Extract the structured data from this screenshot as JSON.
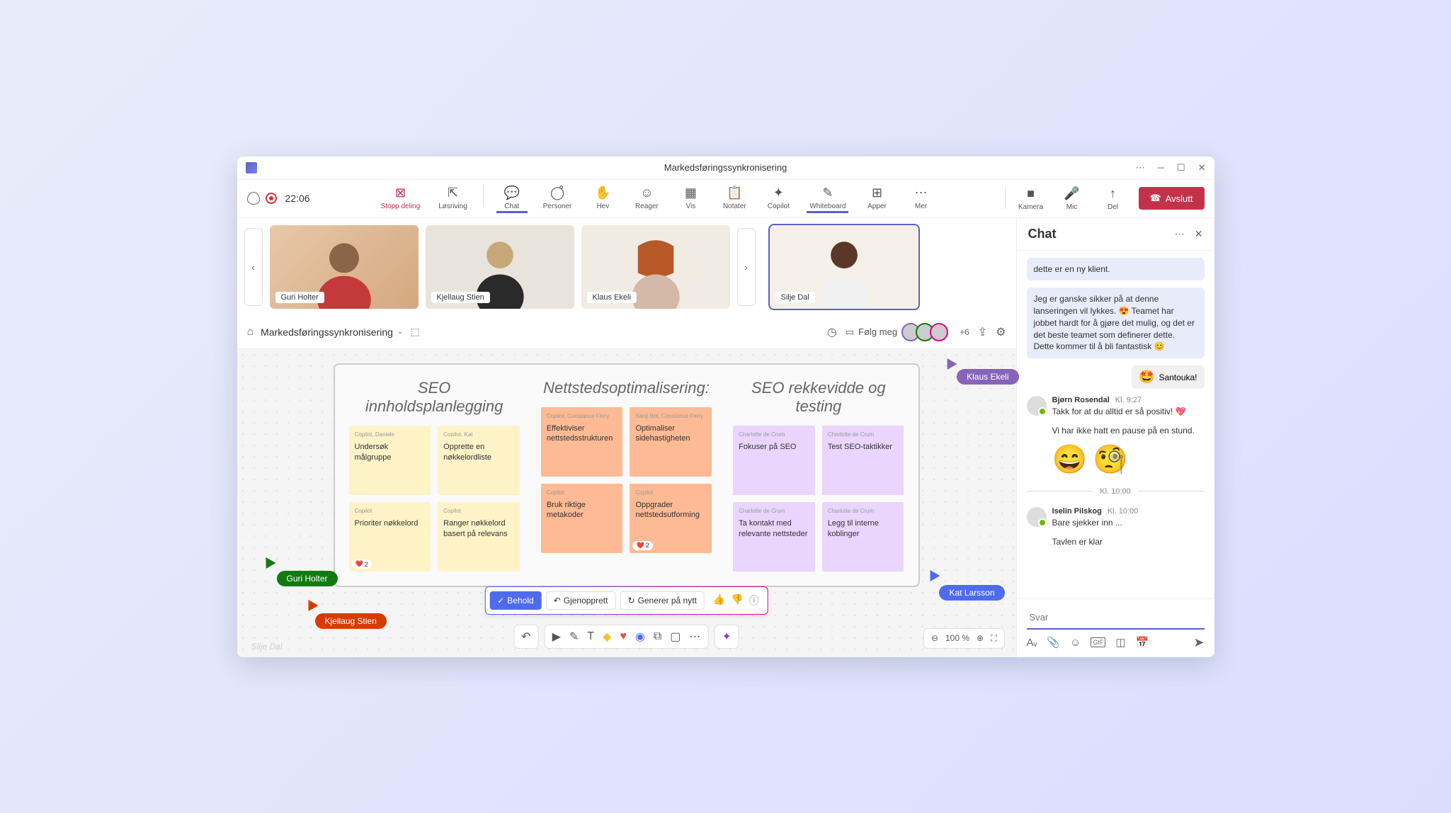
{
  "titlebar": {
    "title": "Markedsføringssynkronisering"
  },
  "meeting": {
    "timer": "22:06"
  },
  "toolbar": {
    "stop_sharing": "Stopp deling",
    "popout": "Løsriving",
    "chat": "Chat",
    "people": "Personer",
    "raise": "Hev",
    "react": "Reager",
    "view": "Vis",
    "notes": "Notater",
    "copilot": "Copilot",
    "whiteboard": "Whiteboard",
    "apps": "Apper",
    "more": "Mer",
    "camera": "Kamera",
    "mic": "Mic",
    "share": "Del",
    "leave": "Avslutt"
  },
  "participants": [
    {
      "name": "Guri Holter"
    },
    {
      "name": "Kjellaug Stien"
    },
    {
      "name": "Klaus Ekeli"
    },
    {
      "name": "Silje Dal"
    }
  ],
  "wb": {
    "title": "Markedsføringssynkronisering",
    "follow": "Følg meg",
    "more_count": "+6",
    "zoom": "100 %",
    "columns": [
      {
        "title": "SEO innholdsplanlegging",
        "color": "yellow",
        "notes": [
          {
            "author": "Copilot, Daniele",
            "text": "Undersøk målgruppe"
          },
          {
            "author": "Copilot, Kat",
            "text": "Opprette en nøkkelordliste"
          },
          {
            "author": "Copilot",
            "text": "Prioriter nøkkelord",
            "reaction": "2"
          },
          {
            "author": "Copilot",
            "text": "Ranger nøkkelord basert på relevans"
          }
        ]
      },
      {
        "title": "Nettstedsoptimalisering:",
        "color": "orange",
        "notes": [
          {
            "author": "Copilot, Constance Ferry",
            "text": "Effektiviser nettstedsstrukturen"
          },
          {
            "author": "Sanji Brit, Constance Ferry",
            "text": "Optimaliser sidehastigheten"
          },
          {
            "author": "Copilot",
            "text": "Bruk riktige metakoder"
          },
          {
            "author": "Copilot",
            "text": "Oppgrader nettstedsutforming",
            "reaction": "2"
          }
        ]
      },
      {
        "title": "SEO rekkevidde og testing",
        "color": "purple",
        "notes": [
          {
            "author": "Charlotte de Crum",
            "text": "Fokuser på SEO"
          },
          {
            "author": "Charlotte de Crum",
            "text": "Test SEO-taktikker"
          },
          {
            "author": "Charlotte de Crum",
            "text": "Ta kontakt med relevante nettsteder"
          },
          {
            "author": "Charlotte de Crum",
            "text": "Legg til interne koblinger"
          }
        ]
      }
    ],
    "cursors": {
      "klaus": "Klaus Ekeli",
      "guri": "Guri Holter",
      "kjellaug": "Kjellaug Stien",
      "kat": "Kat Larsson",
      "silje": "Silje Dal"
    },
    "ai": {
      "keep": "Behold",
      "restore": "Gjenopprett",
      "regenerate": "Generer på nytt"
    }
  },
  "chat": {
    "title": "Chat",
    "msg1": "dette er en ny klient.",
    "msg2": "Jeg er ganske sikker på at denne lanseringen vil lykkes. 😍 Teamet har jobbet hardt for å gjøre det mulig, og det er det beste teamet som definerer dette. Dette kommer til å bli fantastisk 😊",
    "reaction_name": "Santouka!",
    "bjorn": {
      "name": "Bjørn Rosendal",
      "time": "Kl. 9:27",
      "text1": "Takk for at du alltid er så positiv! 💖",
      "text2": "Vi har ikke hatt en pause på en stund."
    },
    "divider_time": "Kl. 10:00",
    "iselin": {
      "name": "Iselin Pilskog",
      "time": "Kl. 10:00",
      "text1": "Bare sjekker inn ...",
      "text2": "Tavlen er klar"
    },
    "placeholder": "Svar"
  }
}
